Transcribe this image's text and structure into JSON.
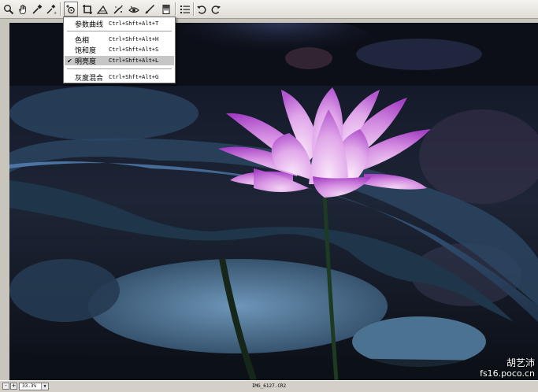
{
  "toolbar": {
    "tools": [
      {
        "name": "zoom-tool",
        "icon": "magnifier-icon"
      },
      {
        "name": "hand-tool",
        "icon": "hand-icon"
      },
      {
        "name": "white-balance-tool",
        "icon": "eyedropper-icon"
      },
      {
        "name": "color-sampler-tool",
        "icon": "color-sampler-icon"
      },
      {
        "name": "targeted-adjustment-tool",
        "icon": "target-adjust-icon"
      },
      {
        "name": "crop-tool",
        "icon": "crop-icon"
      },
      {
        "name": "straighten-tool",
        "icon": "straighten-icon"
      },
      {
        "name": "spot-removal-tool",
        "icon": "spot-removal-icon"
      },
      {
        "name": "red-eye-tool",
        "icon": "red-eye-icon"
      },
      {
        "name": "adjustment-brush-tool",
        "icon": "brush-icon"
      },
      {
        "name": "graduated-filter-tool",
        "icon": "graduated-filter-icon"
      },
      {
        "name": "preferences-tool",
        "icon": "list-icon"
      },
      {
        "name": "rotate-left-tool",
        "icon": "rotate-ccw-icon"
      },
      {
        "name": "rotate-right-tool",
        "icon": "rotate-cw-icon"
      }
    ]
  },
  "menu": {
    "items": [
      {
        "label": "参数曲线",
        "shortcut": "Ctrl+Shft+Alt+T",
        "checked": false,
        "selected": false
      },
      {
        "label": "色相",
        "shortcut": "Ctrl+Shft+Alt+H",
        "checked": false,
        "selected": false
      },
      {
        "label": "饱和度",
        "shortcut": "Ctrl+Shft+Alt+S",
        "checked": false,
        "selected": false
      },
      {
        "label": "明亮度",
        "shortcut": "Ctrl+Shft+Alt+L",
        "checked": true,
        "selected": true
      },
      {
        "label": "灰度混合",
        "shortcut": "Ctrl+Shft+Alt+G",
        "checked": false,
        "selected": false
      }
    ],
    "check_glyph": "✔"
  },
  "photo": {
    "watermark_name": "胡艺沛",
    "watermark_site": "fs16.poco.cn"
  },
  "statusbar": {
    "minus": "-",
    "plus": "+",
    "zoom": "33.3%",
    "zoom_arrow": "▼",
    "filename": "IMG_6127.CR2"
  },
  "colors": {
    "petal": "#c56ad8",
    "petal_light": "#e9b7ee",
    "leaf": "#3e5f7e",
    "menu_selected": "#c6c6c6"
  }
}
